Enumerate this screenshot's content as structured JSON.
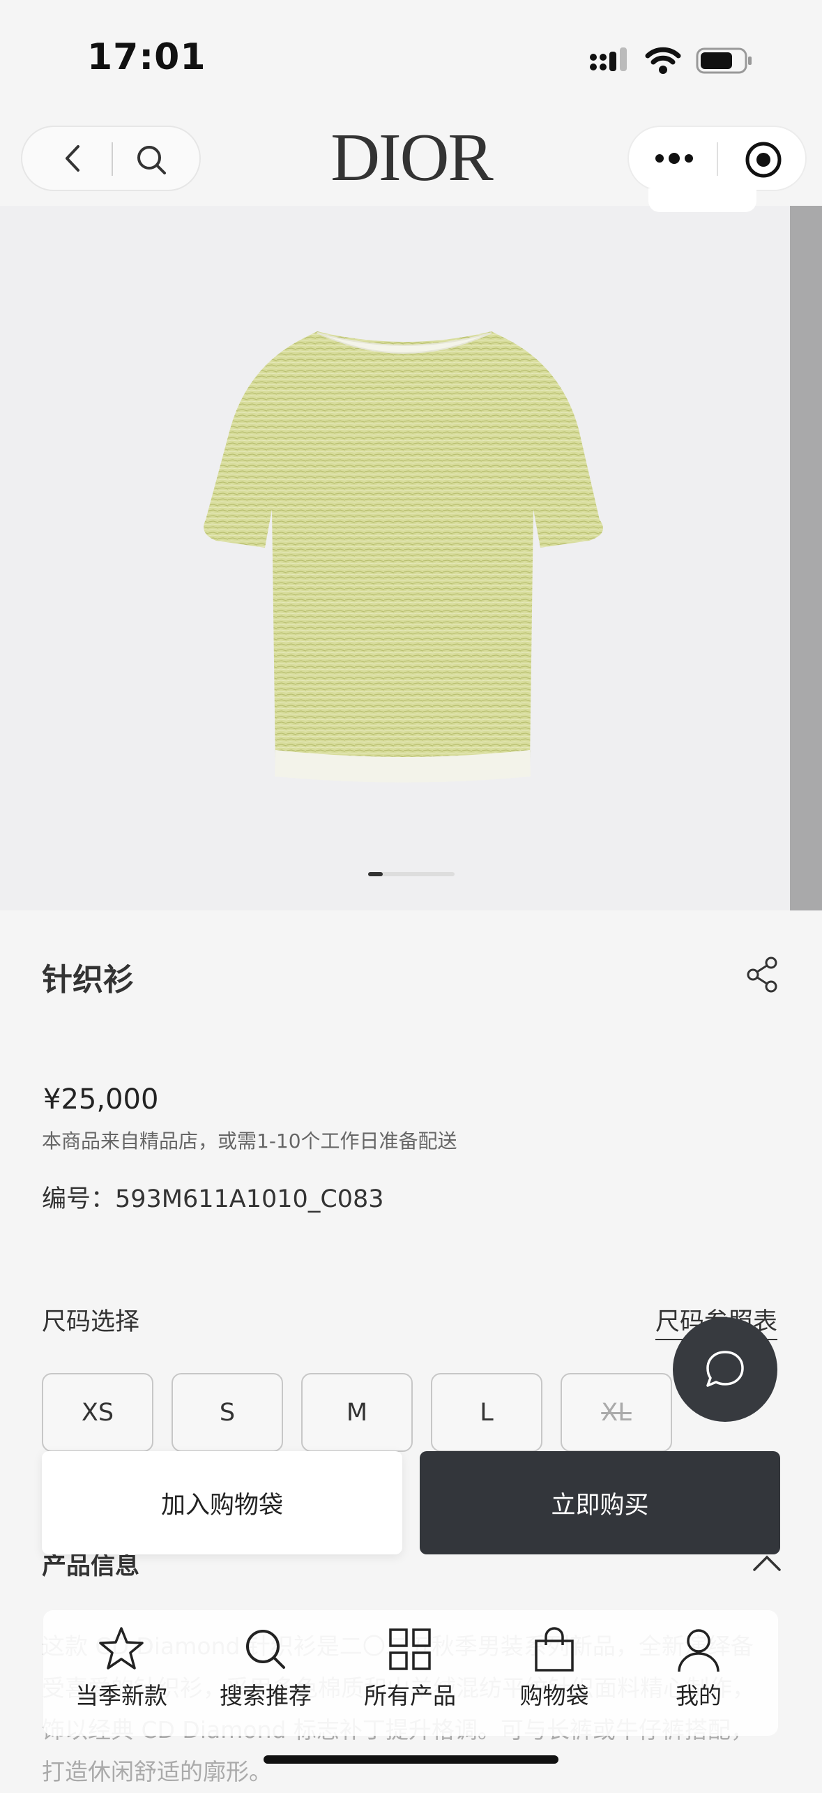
{
  "status_bar": {
    "time": "17:01"
  },
  "nav": {
    "logo": "DIOR"
  },
  "product": {
    "title": "针织衫",
    "price": "¥25,000",
    "shipping_note": "本商品来自精品店，或需1-10个工作日准备配送",
    "code": "编号：593M611A1010_C083",
    "image_index": 1,
    "image_count": 6
  },
  "sizes": {
    "label": "尺码选择",
    "chart_link": "尺码参照表",
    "options": [
      {
        "label": "XS",
        "available": true
      },
      {
        "label": "S",
        "available": true
      },
      {
        "label": "M",
        "available": true
      },
      {
        "label": "L",
        "available": true
      },
      {
        "label": "XL",
        "available": false
      }
    ]
  },
  "actions": {
    "add_to_bag": "加入购物袋",
    "buy_now": "立即购买"
  },
  "info": {
    "heading": "产品信息",
    "description": "这款 CD Diamond 针织衫是二〇二五秋季男装系列新品，全新演绎备受喜爱的针织衫，采用多色棉质和山羊绒混纺平纹针织面料精心制作，饰以经典 CD Diamond 标志补丁提升格调。可与长裤或牛仔裤搭配，打造休闲舒适的廓形。"
  },
  "tabbar": {
    "items": [
      {
        "label": "当季新款",
        "icon": "star-icon"
      },
      {
        "label": "搜索推荐",
        "icon": "search-icon"
      },
      {
        "label": "所有产品",
        "icon": "grid-icon"
      },
      {
        "label": "购物袋",
        "icon": "bag-icon"
      },
      {
        "label": "我的",
        "icon": "user-icon"
      }
    ]
  },
  "colors": {
    "dark": "#33363b",
    "background": "#f5f5f5",
    "shirt": "#d6dc97"
  }
}
